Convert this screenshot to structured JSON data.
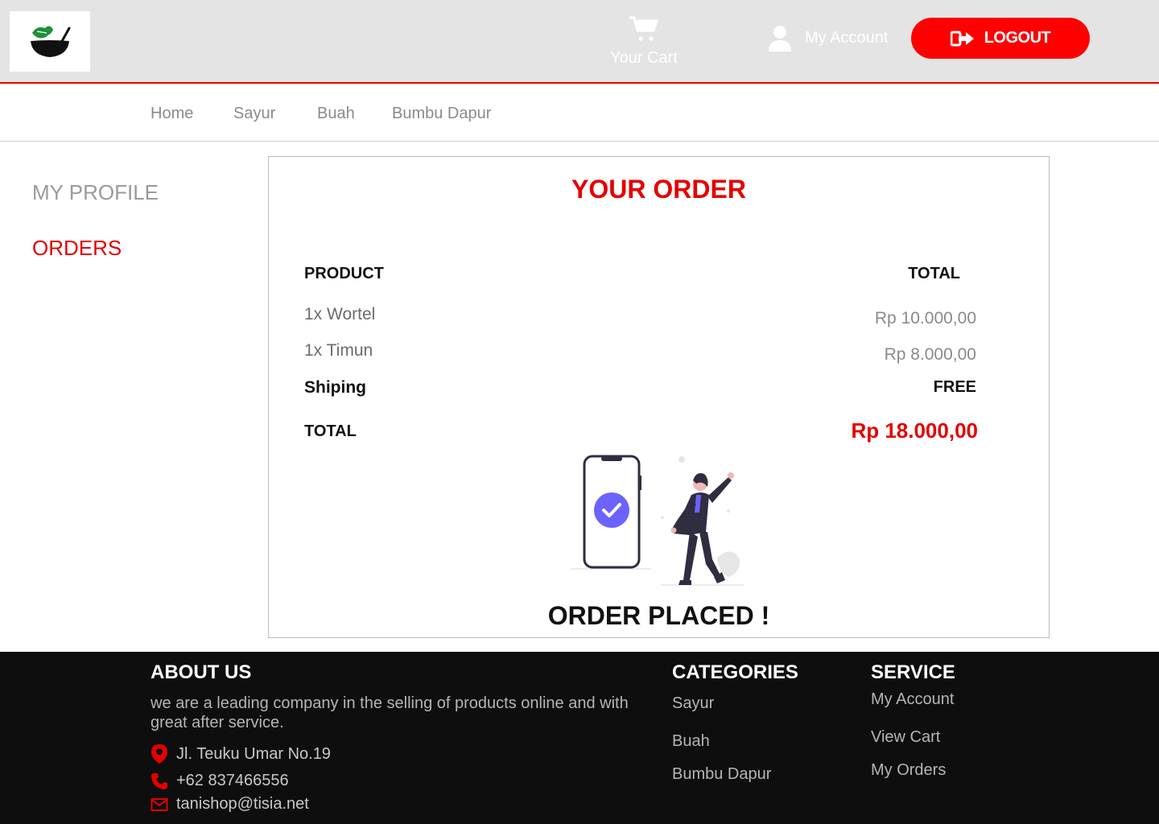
{
  "header": {
    "logo_icon": "salad-bowl-logo",
    "cart_label": "Your Cart",
    "account_label": "My Account",
    "logout_label": "LOGOUT",
    "accent": "#ff0000"
  },
  "nav": {
    "items": [
      "Home",
      "Sayur",
      "Buah",
      "Bumbu Dapur"
    ]
  },
  "sidebar": {
    "profile": "MY PROFILE",
    "orders": "ORDERS"
  },
  "order": {
    "title": "YOUR ORDER",
    "col_product": "PRODUCT",
    "col_total": "TOTAL",
    "items": [
      {
        "name": "1x Wortel",
        "price": "Rp 10.000,00"
      },
      {
        "name": "1x Timun",
        "price": "Rp 8.000,00"
      }
    ],
    "shipping_label": "Shiping",
    "shipping_value": "FREE",
    "total_label": "TOTAL",
    "total_value": "Rp 18.000,00",
    "status": "ORDER PLACED !"
  },
  "footer": {
    "about_title": "ABOUT US",
    "about_text": "we are a leading company in the selling of products online and with great after service.",
    "address": "Jl. Teuku Umar No.19",
    "phone": "+62 837466556",
    "email": "tanishop@tisia.net",
    "categories_title": "CATEGORIES",
    "categories": [
      "Sayur",
      "Buah",
      "Bumbu Dapur"
    ],
    "service_title": "SERVICE",
    "service": [
      "My Account",
      "View Cart",
      "My Orders"
    ]
  }
}
